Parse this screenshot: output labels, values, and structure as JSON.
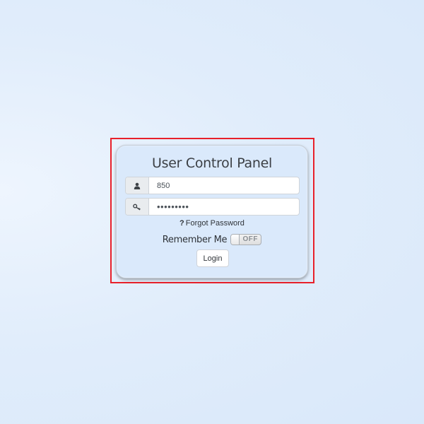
{
  "panel": {
    "title": "User Control Panel"
  },
  "username": {
    "value": "850",
    "icon": "user-icon"
  },
  "password": {
    "value": "•••••••••",
    "icon": "key-icon"
  },
  "forgot": {
    "icon": "question-icon",
    "icon_text": "?",
    "label": "Forgot Password"
  },
  "remember": {
    "label": "Remember Me",
    "toggle_state": "OFF"
  },
  "login": {
    "label": "Login"
  },
  "colors": {
    "highlight": "#e8202a",
    "panel_bg": "#dae9fb",
    "page_bg": "#dde9fb"
  }
}
